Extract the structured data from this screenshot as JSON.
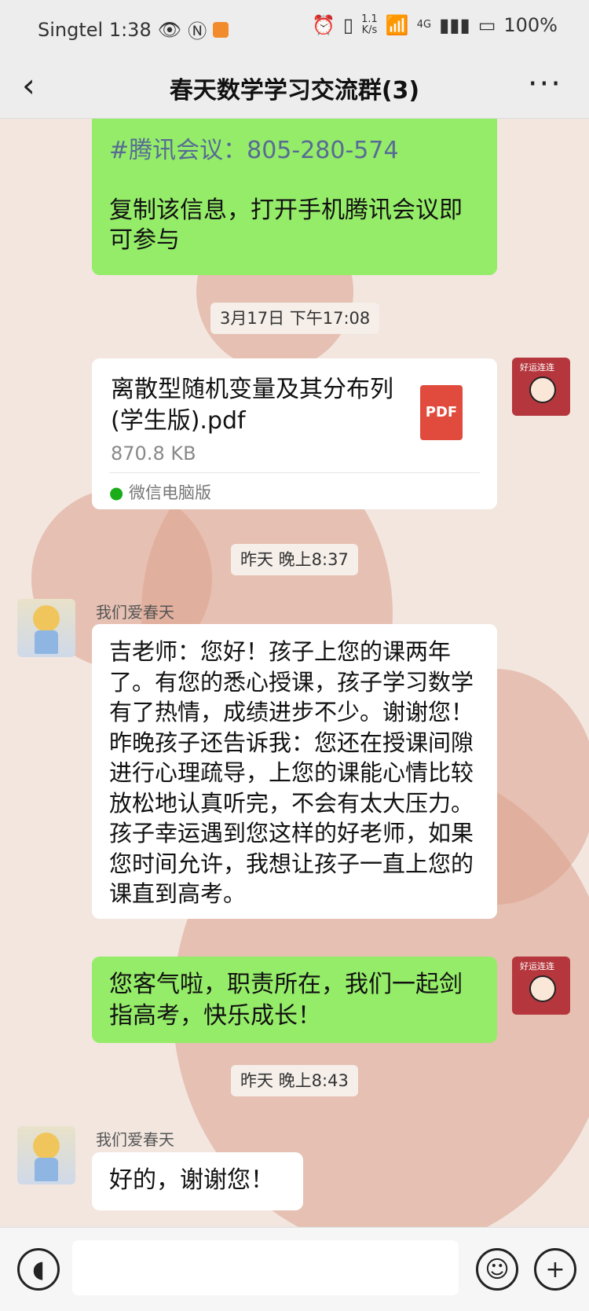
{
  "status_bar": {
    "carrier_time": "Singtel 1:38",
    "net_speed": "1.1",
    "net_speed_unit": "K/s",
    "signal_type": "4G",
    "battery": "100%"
  },
  "header": {
    "back_icon": "back-chevron-icon",
    "title": "春天数学学习交流群(3)",
    "more_icon": "more-dots-icon"
  },
  "messages": {
    "m1": {
      "meeting_line": "#腾讯会议：805-280-574",
      "copy_text": "复制该信息，打开手机腾讯会议即可参与"
    },
    "time1": "3月17日 下午17:08",
    "file": {
      "name": "离散型随机变量及其分布列(学生版).pdf",
      "size": "870.8 KB",
      "source": "微信电脑版",
      "icon_label": "PDF"
    },
    "time2": "昨天 晚上8:37",
    "her1": {
      "sender": "我们爱春天",
      "text": "吉老师：您好！孩子上您的课两年了。有您的悉心授课，孩子学习数学有了热情，成绩进步不少。谢谢您！昨晚孩子还告诉我：您还在授课间隙进行心理疏导，上您的课能心情比较放松地认真听完，不会有太大压力。孩子幸运遇到您这样的好老师，如果您时间允许，我想让孩子一直上您的课直到高考。"
    },
    "me2": {
      "text": "您客气啦，职责所在，我们一起剑指高考，快乐成长！"
    },
    "time3": "昨天 晚上8:43",
    "her2": {
      "sender": "我们爱春天",
      "text": "好的，谢谢您！"
    }
  },
  "avatars": {
    "me_label": "好运连连"
  },
  "bottom_bar": {
    "voice_icon": "voice-icon",
    "emoji_icon": "emoji-icon",
    "plus_icon": "plus-icon"
  }
}
